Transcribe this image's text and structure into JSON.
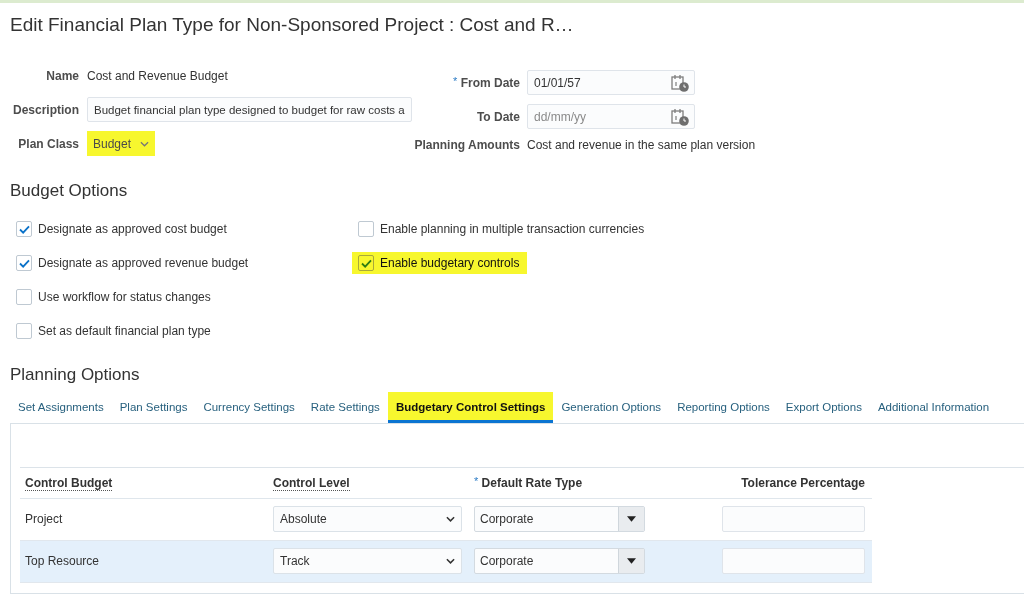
{
  "page": {
    "title": "Edit Financial Plan Type for Non-Sponsored Project : Cost and R…"
  },
  "form": {
    "left_fields": [
      {
        "kind": "text",
        "label": "Name",
        "value": "Cost and Revenue Budget",
        "highlighted": false
      },
      {
        "kind": "input",
        "label": "Description",
        "value": "Budget financial plan type designed to budget for raw costs a",
        "highlighted": false
      },
      {
        "kind": "select",
        "label": "Plan Class",
        "value": "Budget",
        "disabled": true,
        "highlighted": true
      }
    ],
    "right_fields": [
      {
        "kind": "date",
        "label": "From Date",
        "required_mark": "*",
        "value": "01/01/57",
        "highlighted": false
      },
      {
        "kind": "date",
        "label": "To Date",
        "placeholder": "dd/mm/yy",
        "highlighted": false
      },
      {
        "kind": "text",
        "label": "Planning Amounts",
        "value": "Cost and revenue in the same plan version",
        "highlighted": false
      }
    ]
  },
  "budget_options": {
    "title": "Budget Options",
    "columns": [
      {
        "items": [
          {
            "label": "Designate as approved cost budget",
            "checked": true,
            "highlighted": false
          },
          {
            "label": "Designate as approved revenue budget",
            "checked": true,
            "highlighted": false
          },
          {
            "label": "Use workflow for status changes",
            "checked": false,
            "highlighted": false
          },
          {
            "label": "Set as default financial plan type",
            "checked": false,
            "highlighted": false
          }
        ]
      },
      {
        "items": [
          {
            "label": "Enable planning in multiple transaction currencies",
            "checked": false,
            "highlighted": false
          },
          {
            "label": "Enable budgetary controls",
            "checked": true,
            "highlighted": true
          }
        ]
      }
    ]
  },
  "planning_options": {
    "title": "Planning Options",
    "tabs": [
      {
        "label": "Set Assignments",
        "selected": false,
        "highlighted": false
      },
      {
        "label": "Plan Settings",
        "selected": false,
        "highlighted": false
      },
      {
        "label": "Currency Settings",
        "selected": false,
        "highlighted": false
      },
      {
        "label": "Rate Settings",
        "selected": false,
        "highlighted": false
      },
      {
        "label": "Budgetary Control Settings",
        "selected": true,
        "highlighted": true
      },
      {
        "label": "Generation Options",
        "selected": false,
        "highlighted": false
      },
      {
        "label": "Reporting Options",
        "selected": false,
        "highlighted": false
      },
      {
        "label": "Export Options",
        "selected": false,
        "highlighted": false
      },
      {
        "label": "Additional Information",
        "selected": false,
        "highlighted": false
      }
    ],
    "table": {
      "columns": [
        {
          "label": "Control Budget",
          "underlined": true
        },
        {
          "label": "Control Level",
          "underlined": true
        },
        {
          "label": "Default Rate Type",
          "required_mark": "*",
          "underlined": false
        },
        {
          "label": "Tolerance Percentage",
          "underlined": false
        }
      ],
      "rows": [
        {
          "control_budget": "Project",
          "control_level": "Absolute",
          "default_rate_type": "Corporate",
          "selected": false
        },
        {
          "control_budget": "Top Resource",
          "control_level": "Track",
          "default_rate_type": "Corporate",
          "selected": true
        }
      ]
    }
  }
}
